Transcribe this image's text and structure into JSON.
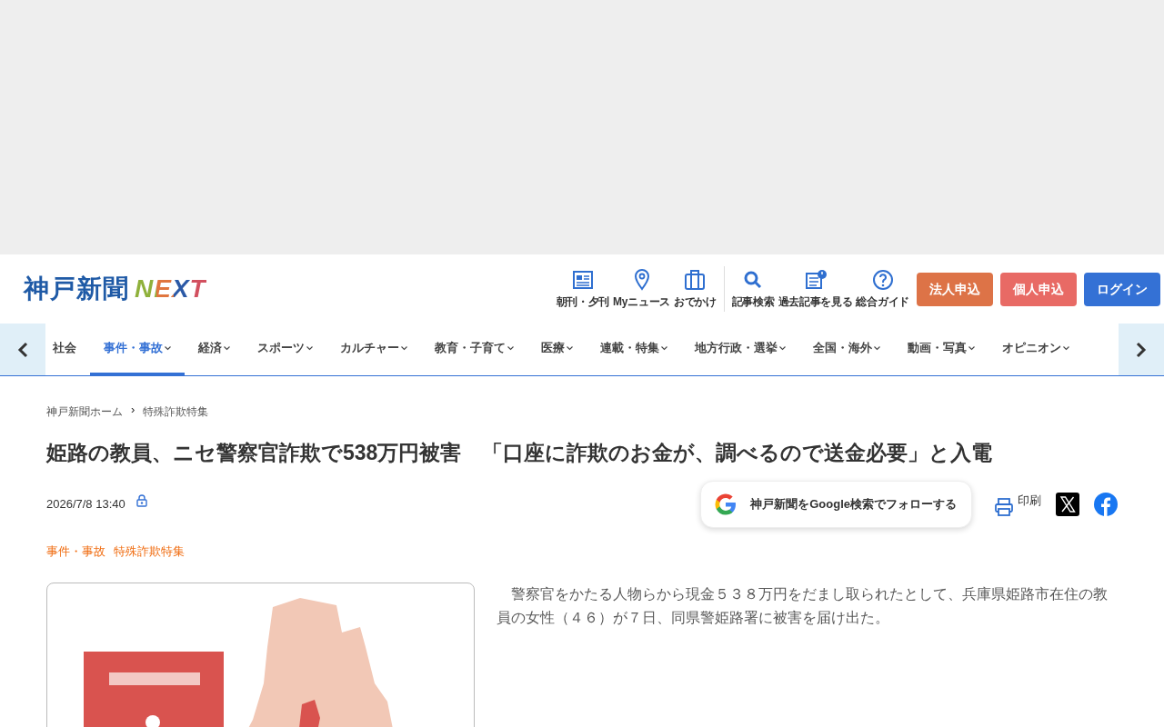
{
  "header": {
    "logo": {
      "text": "神戸新聞",
      "accent": "NEXT"
    },
    "tools": [
      {
        "label": "朝刊・夕刊",
        "kind": "paper"
      },
      {
        "label": "Myニュース",
        "kind": "pin"
      },
      {
        "label": "おでかけ",
        "kind": "bag"
      },
      {
        "label": "記事検索",
        "kind": "search"
      },
      {
        "label": "過去記事を見る",
        "kind": "archive"
      },
      {
        "label": "総合ガイド",
        "kind": "help"
      }
    ],
    "buttons": [
      {
        "label": "法人申込",
        "color": "#dd7347"
      },
      {
        "label": "個人申込",
        "color": "#e86a65"
      },
      {
        "label": "ログイン",
        "color": "#3471d5"
      }
    ]
  },
  "nav": {
    "items": [
      {
        "label": "社会",
        "selected": false,
        "dropdown": false
      },
      {
        "label": "事件・事故",
        "selected": true,
        "dropdown": true
      },
      {
        "label": "経済",
        "selected": false,
        "dropdown": true
      },
      {
        "label": "スポーツ",
        "selected": false,
        "dropdown": true
      },
      {
        "label": "カルチャー",
        "selected": false,
        "dropdown": true
      },
      {
        "label": "教育・子育て",
        "selected": false,
        "dropdown": true
      },
      {
        "label": "医療",
        "selected": false,
        "dropdown": true
      },
      {
        "label": "連載・特集",
        "selected": false,
        "dropdown": true
      },
      {
        "label": "地方行政・選挙",
        "selected": false,
        "dropdown": true
      },
      {
        "label": "全国・海外",
        "selected": false,
        "dropdown": true
      },
      {
        "label": "動画・写真",
        "selected": false,
        "dropdown": true
      },
      {
        "label": "オピニオン",
        "selected": false,
        "dropdown": true
      }
    ]
  },
  "breadcrumb": [
    {
      "label": "神戸新聞ホーム"
    },
    {
      "label": "›",
      "kind": "sep"
    },
    {
      "label": "特殊詐欺特集"
    }
  ],
  "article": {
    "title": "姫路の教員、ニセ警察官詐欺で538万円被害　「口座に詐欺のお金が、調べるので送金必要」と入電",
    "date": "2026/7/8 13:40",
    "locked": true,
    "follow_button": "神戸新聞をGoogle検索でフォローする",
    "print": "印刷",
    "tags": [
      {
        "label": "事件・事故"
      },
      {
        "label": "特殊詐欺特集"
      }
    ],
    "body": "　警察官をかたる人物らから現金５３８万円をだまし取られたとして、兵庫県姫路市在住の教員の女性（４６）が７日、同県警姫路署に被害を届け出た。"
  }
}
